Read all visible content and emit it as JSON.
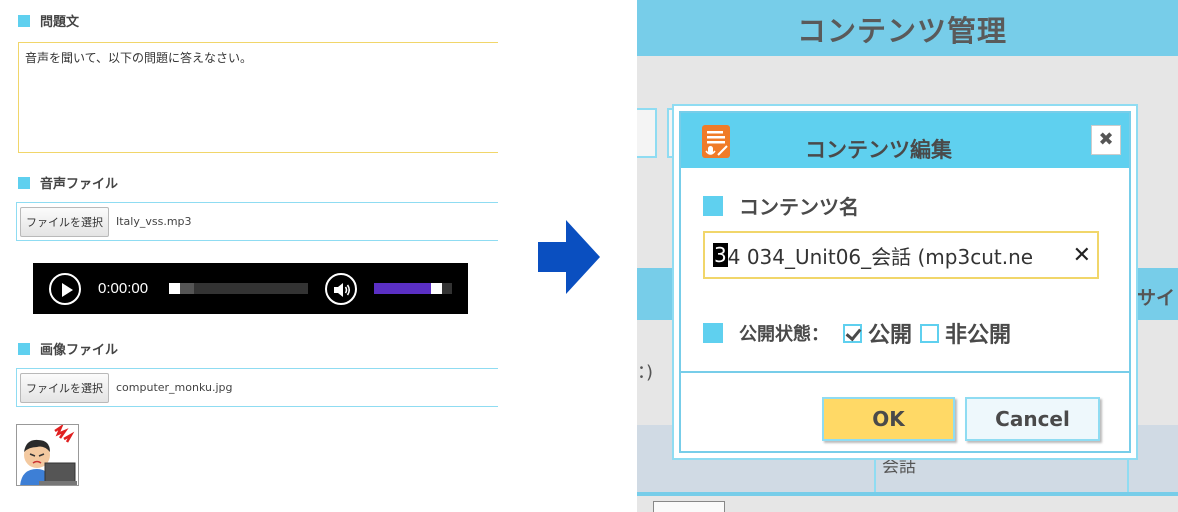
{
  "left": {
    "question": {
      "heading": "問題文",
      "text": "音声を聞いて、以下の問題に答えなさい。"
    },
    "audio_file": {
      "heading": "音声ファイル",
      "button": "ファイルを選択",
      "filename": "Italy_vss.mp3"
    },
    "player": {
      "time": "0:00:00",
      "progress": 0,
      "volume": 0.85
    },
    "image_file": {
      "heading": "画像ファイル",
      "button": "ファイルを選択",
      "filename": "computer_monku.jpg"
    }
  },
  "right": {
    "page_title": "コンテンツ管理",
    "bg_bar_text": "サイ",
    "bg_paren": "：)",
    "bg_lower_text": "会話",
    "dialog": {
      "title": "コンテンツ編集",
      "close": "✖",
      "name_label": "コンテンツ名",
      "name_value_caret": "3",
      "name_value_rest": "4 034_Unit06_会話 (mp3cut.ne",
      "clear": "✕",
      "status_label": "公開状態：",
      "opt_public": "公開",
      "opt_private": "非公開",
      "ok": "OK",
      "cancel": "Cancel"
    }
  },
  "colors": {
    "accent": "#5fd0ef",
    "header": "#77cde9",
    "ok": "#ffd966",
    "arrow": "#0a4fc0"
  }
}
